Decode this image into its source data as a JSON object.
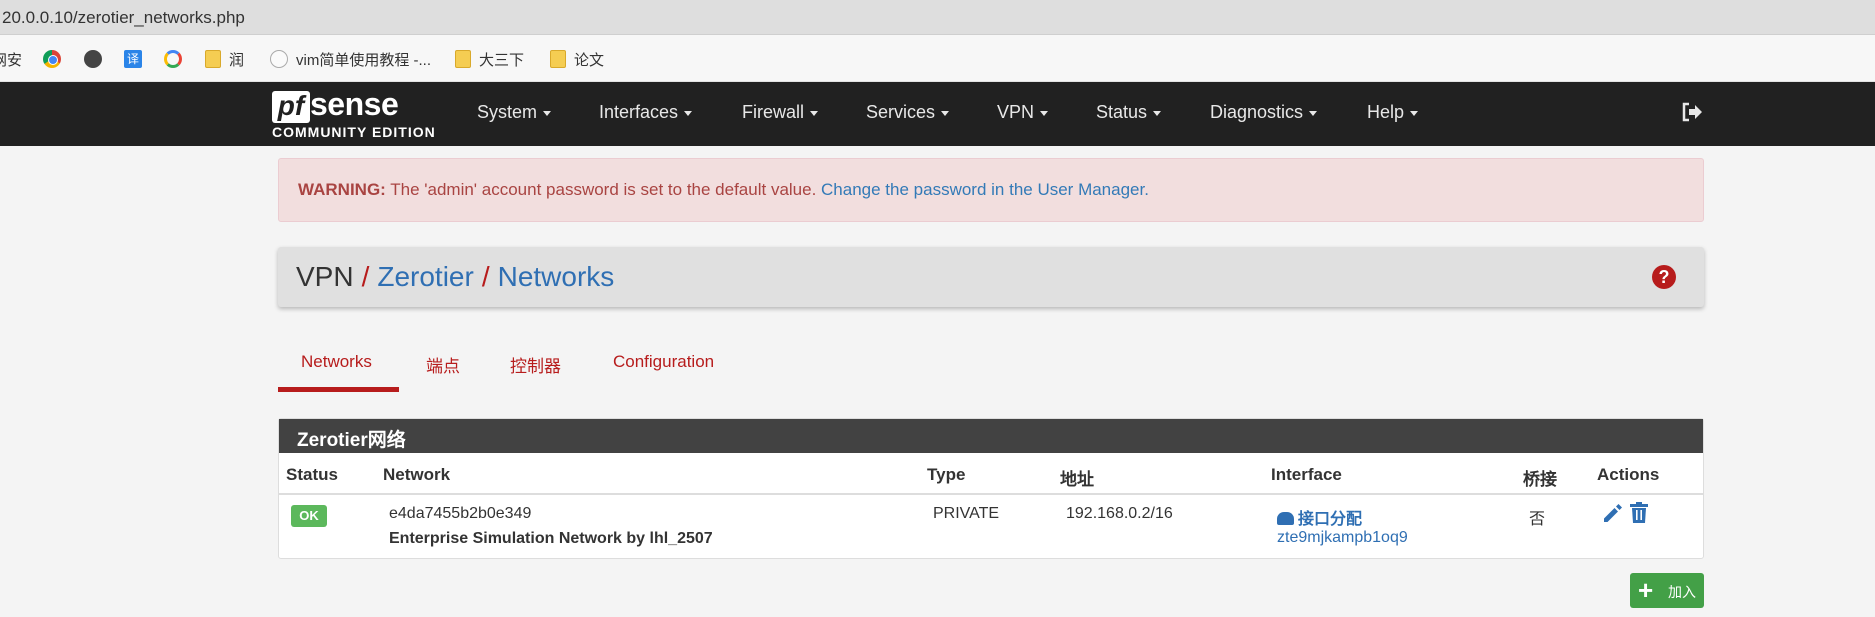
{
  "browser": {
    "url": "20.0.0.10/zerotier_networks.php",
    "bookmarks": [
      "网安",
      "",
      "",
      "",
      "",
      "润",
      "vim简单使用教程 -...",
      "大三下",
      "论文"
    ]
  },
  "navbar": {
    "logo_pf": "pf",
    "logo_sense": "sense",
    "logo_edition": "COMMUNITY EDITION",
    "items": [
      "System",
      "Interfaces",
      "Firewall",
      "Services",
      "VPN",
      "Status",
      "Diagnostics",
      "Help"
    ]
  },
  "warning": {
    "label": "WARNING:",
    "text": " The 'admin' account password is set to the default value. ",
    "link": "Change the password in the User Manager."
  },
  "breadcrumb": {
    "root": "VPN",
    "level1": "Zerotier",
    "level2": "Networks",
    "separator": "/"
  },
  "tabs": [
    "Networks",
    "端点",
    "控制器",
    "Configuration"
  ],
  "panel": {
    "title": "Zerotier网络",
    "columns": [
      "Status",
      "Network",
      "Type",
      "地址",
      "Interface",
      "桥接",
      "Actions"
    ],
    "rows": [
      {
        "status": "OK",
        "network_id": "e4da7455b2b0e349",
        "network_name": "Enterprise Simulation Network by lhl_2507",
        "type": "PRIVATE",
        "address": "192.168.0.2/16",
        "interface_action": "接口分配",
        "interface_id": "zte9mjkampb1oq9",
        "bridge": "否"
      }
    ]
  },
  "add_button": {
    "label": "加入"
  },
  "colors": {
    "accent": "#b71c1c",
    "navbar": "#212121",
    "link": "#2f6fb3",
    "success": "#5cb85c"
  }
}
